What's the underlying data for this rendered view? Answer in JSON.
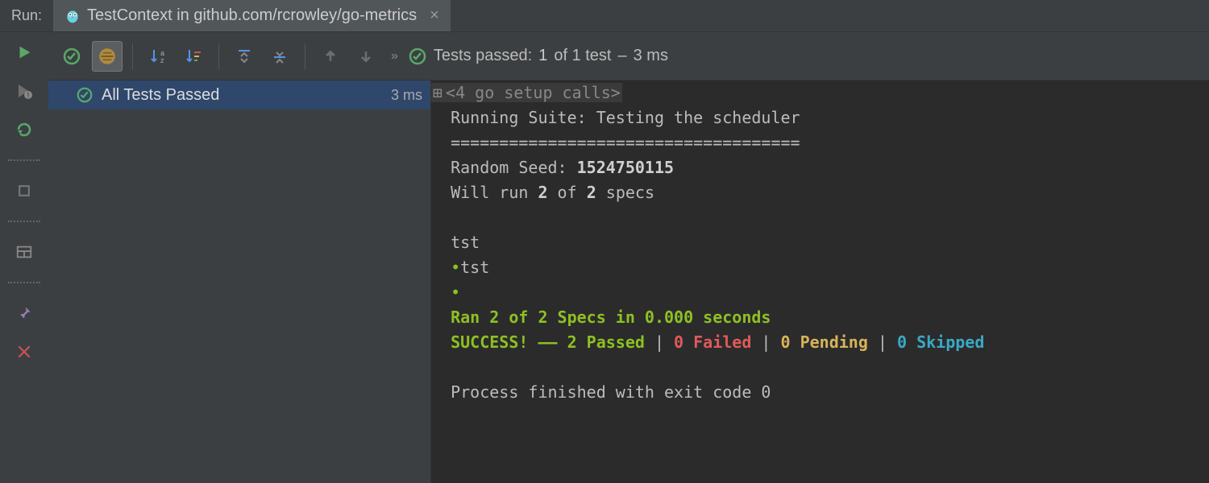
{
  "header": {
    "run_label": "Run:",
    "tab_title": "TestContext in github.com/rcrowley/go-metrics"
  },
  "toolbar": {
    "status_prefix": "Tests passed:",
    "status_passed": "1",
    "status_of": "of 1 test",
    "status_dash": "–",
    "status_time": "3 ms"
  },
  "tree": {
    "root_label": "All Tests Passed",
    "root_time": "3 ms"
  },
  "console": {
    "fold_label": "<4 go setup calls>",
    "line_suite": "Running Suite: Testing the scheduler",
    "line_hr": "====================================",
    "seed_label": "Random Seed: ",
    "seed_value": "1524750115",
    "will_run_a": "Will run ",
    "will_run_b": "2",
    "will_run_c": " of ",
    "will_run_d": "2",
    "will_run_e": " specs",
    "tst1": "tst",
    "tst2": "tst",
    "ran_line": "Ran 2 of 2 Specs in 0.000 seconds",
    "success": "SUCCESS!",
    "dashes": " —— ",
    "passed": "2 Passed",
    "pipe": " | ",
    "failed": "0 Failed",
    "pending": "0 Pending",
    "skipped": "0 Skipped",
    "exit": "Process finished with exit code 0"
  }
}
